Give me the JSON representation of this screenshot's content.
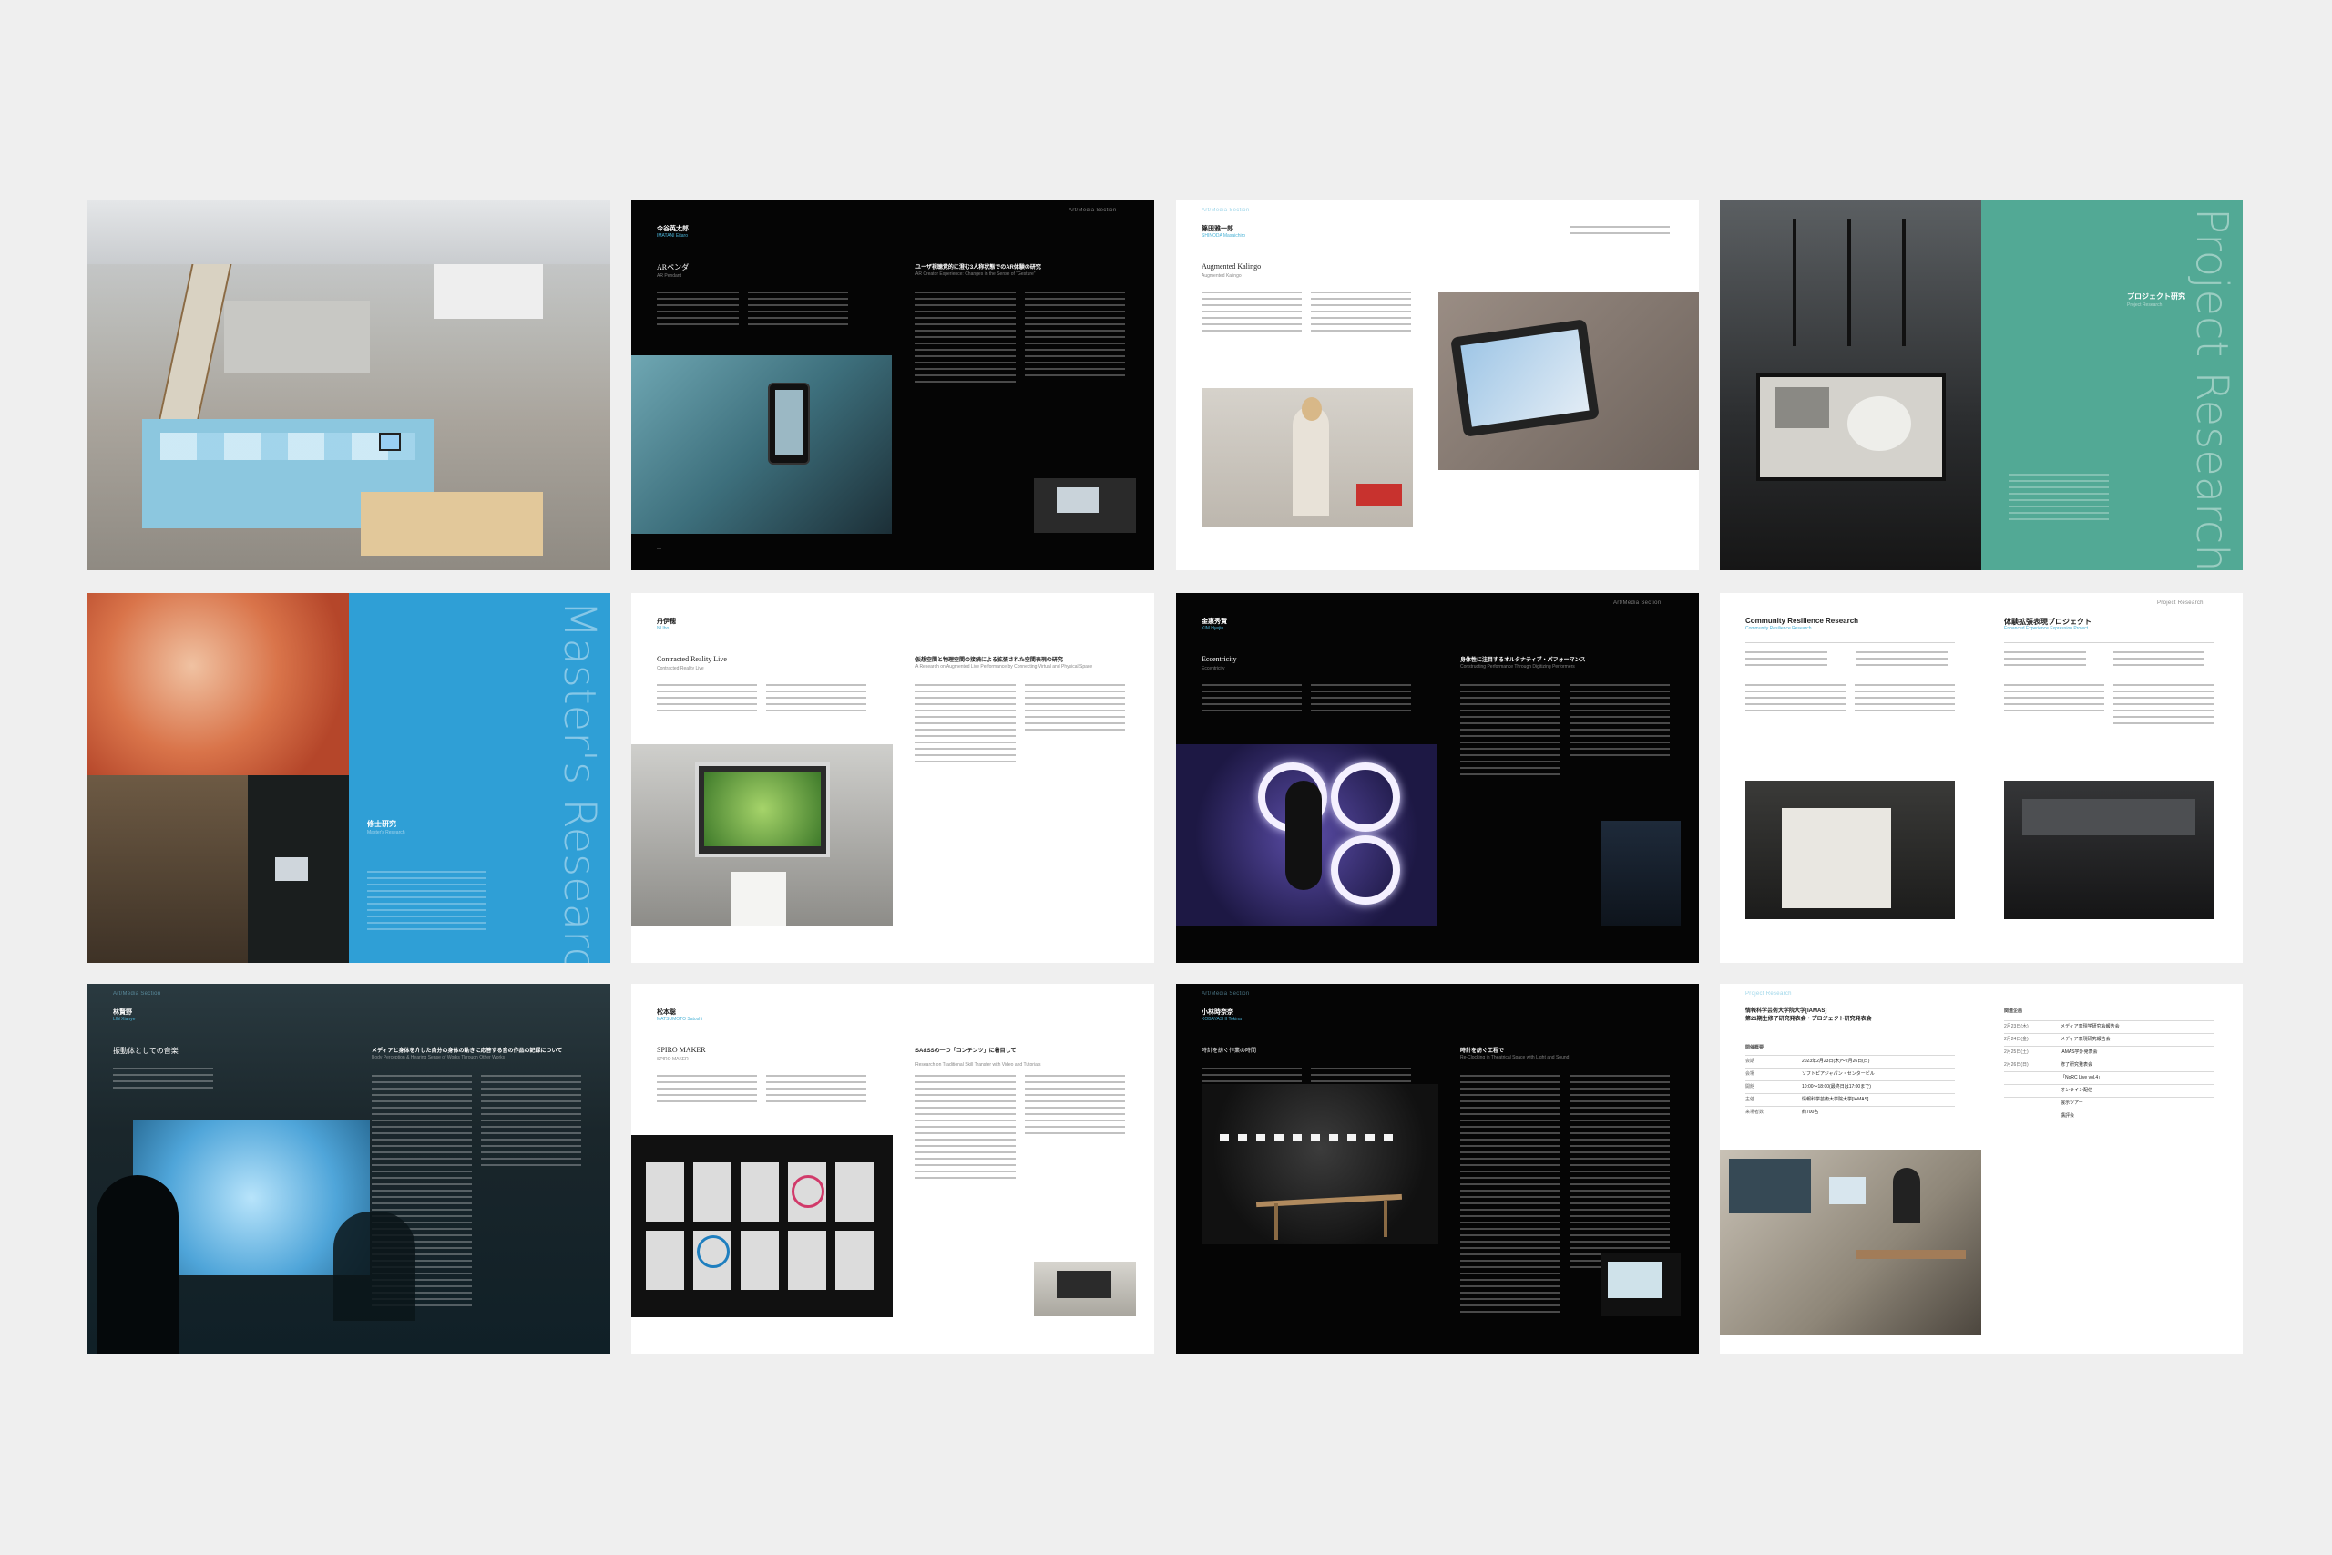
{
  "row1": {
    "s2": {
      "header_right": "Art/Media Section",
      "name": "今谷英太郎",
      "roman": "IMATANI Eitaro",
      "work": "ARペンダ",
      "work_sub": "AR Pendant",
      "essay_title": "ユーザ視聴覚的に澄む3人称状態でのAR体験の研究",
      "essay_title_en": "AR Creator Experience: Changes in the Sense of “Gesture”"
    },
    "s3": {
      "header": "Art/Media Section",
      "name": "篠田雅一郎",
      "roman": "SHINODA Masaichiro",
      "work": "Augmented Kalingo",
      "work_sub": "Augmented Kalingo"
    },
    "s4": {
      "section_ja": "プロジェクト研究",
      "section_en": "Project Research",
      "vertical": "Project Research"
    }
  },
  "row2": {
    "s1": {
      "section_ja": "修士研究",
      "section_en": "Master's Research",
      "vertical": "Master's Research"
    },
    "s2": {
      "name": "丹伊穂",
      "roman": "NI Iho",
      "work": "Contracted Reality Live",
      "work_sub": "Contracted Reality Live",
      "essay_title": "仮想空間と物理空間の接続による拡張された空間表現の研究",
      "essay_title_en": "A Research on Augmented Live Performance by Connecting Virtual and Physical Space"
    },
    "s3": {
      "header": "Art/Media Section",
      "name": "金惠秀賢",
      "roman": "KIM Hyejin",
      "work": "Eccentricity",
      "work_sub": "Eccentricity",
      "essay_title": "身体性に注目するオルタナティブ・パフォーマンス",
      "essay_title_en": "Constructing Performance Through Digitizing Performers"
    },
    "s4": {
      "header": "Project Research",
      "title1": "Community Resilience Research",
      "sub1": "Community Resilience Research",
      "title2": "体験拡張表現プロジェクト",
      "sub2": "Enhanced Experience Expression Project"
    }
  },
  "row3": {
    "s1": {
      "header": "Art/Media Section",
      "name": "林賢野",
      "roman": "LIN Xianye",
      "work": "振動体としての音楽",
      "essay_title": "メディアと身体を介した自分の身体の動きに応答する音の作品の記録について",
      "essay_title_en": "Body Perception & Hearing Sense of Works Through Other Works"
    },
    "s2": {
      "name": "松本聡",
      "roman": "MATSUMOTO Satoshi",
      "work": "SPIRO MAKER",
      "work_sub": "SPIRO MAKER",
      "essay_title": "SA&SSの一つ「コンテンツ」に着目して",
      "essay_title_en": "Research on Traditional Skill Transfer with Video and Tutorials"
    },
    "s3": {
      "header": "Art/Media Section",
      "name": "小林時奈奈",
      "roman": "KOBAYASHI Tokina",
      "work": "時計を紡ぐ作業の時間",
      "essay_title": "時計を紡ぐ工程で",
      "essay_title_en": "Re-Clocking in Theatrical Space with Light and Sound"
    },
    "s4": {
      "header": "Project Research",
      "title": "情報科学芸術大学院大学[IAMAS]\n第21期生修了研究発表会・プロジェクト研究発表会",
      "info_label": "開催概要",
      "info_rows": [
        {
          "label": "会期",
          "value": "2023年2月23日(木)〜2月26日(日)"
        },
        {
          "label": "会場",
          "value": "ソフトピアジャパン・センタービル"
        },
        {
          "label": "開館",
          "value": "10:00〜18:00(最終日は17:00まで)"
        },
        {
          "label": "主催",
          "value": "情報科学芸術大学院大学[IAMAS]"
        },
        {
          "label": "来場者数",
          "value": "約700名"
        }
      ],
      "right_label": "関連企画",
      "right_rows": [
        {
          "label": "2月23日(木)",
          "value": "メディア表現学研究会報告会"
        },
        {
          "label": "2月24日(金)",
          "value": "メディア表現研究報告会"
        },
        {
          "label": "2月25日(土)",
          "value": "IAMAS学外発表会"
        },
        {
          "label": "2月26日(日)",
          "value": "修了研究発表会"
        },
        {
          "label": "",
          "value": "「NoRC Live vol.4」"
        },
        {
          "label": "",
          "value": "オンライン配信"
        },
        {
          "label": "",
          "value": "展示ツアー"
        },
        {
          "label": "",
          "value": "講評会"
        }
      ]
    }
  }
}
